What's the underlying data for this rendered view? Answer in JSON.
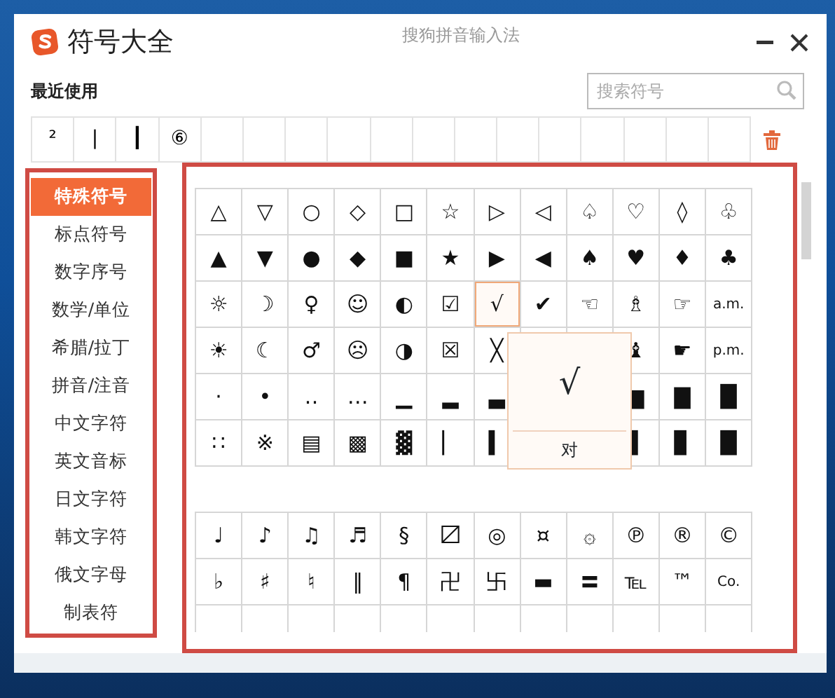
{
  "window": {
    "title": "符号大全",
    "subtitle": "搜狗拼音输入法"
  },
  "recent": {
    "label": "最近使用",
    "items": [
      "²",
      "|",
      "┃",
      "⑥"
    ]
  },
  "search": {
    "placeholder": "搜索符号"
  },
  "sidebar": {
    "items": [
      {
        "label": "特殊符号",
        "selected": true
      },
      {
        "label": "标点符号",
        "selected": false
      },
      {
        "label": "数字序号",
        "selected": false
      },
      {
        "label": "数学/单位",
        "selected": false
      },
      {
        "label": "希腊/拉丁",
        "selected": false
      },
      {
        "label": "拼音/注音",
        "selected": false
      },
      {
        "label": "中文字符",
        "selected": false
      },
      {
        "label": "英文音标",
        "selected": false
      },
      {
        "label": "日文字符",
        "selected": false
      },
      {
        "label": "韩文字符",
        "selected": false
      },
      {
        "label": "俄文字母",
        "selected": false
      },
      {
        "label": "制表符",
        "selected": false
      }
    ]
  },
  "blocks": [
    {
      "rows": [
        [
          {
            "symbol": "△",
            "selected": false
          },
          {
            "symbol": "▽",
            "selected": false
          },
          {
            "symbol": "○",
            "selected": false
          },
          {
            "symbol": "◇",
            "selected": false
          },
          {
            "symbol": "□",
            "selected": false
          },
          {
            "symbol": "☆",
            "selected": false
          },
          {
            "symbol": "▷",
            "selected": false
          },
          {
            "symbol": "◁",
            "selected": false
          },
          {
            "symbol": "♤",
            "selected": false
          },
          {
            "symbol": "♡",
            "selected": false
          },
          {
            "symbol": "◊",
            "selected": false
          },
          {
            "symbol": "♧",
            "selected": false
          }
        ],
        [
          {
            "symbol": "▲",
            "selected": false
          },
          {
            "symbol": "▼",
            "selected": false
          },
          {
            "symbol": "●",
            "selected": false
          },
          {
            "symbol": "◆",
            "selected": false
          },
          {
            "symbol": "■",
            "selected": false
          },
          {
            "symbol": "★",
            "selected": false
          },
          {
            "symbol": "▶",
            "selected": false
          },
          {
            "symbol": "◀",
            "selected": false
          },
          {
            "symbol": "♠",
            "selected": false
          },
          {
            "symbol": "♥",
            "selected": false
          },
          {
            "symbol": "♦",
            "selected": false
          },
          {
            "symbol": "♣",
            "selected": false
          }
        ],
        [
          {
            "symbol": "☼",
            "selected": false
          },
          {
            "symbol": "☽",
            "selected": false
          },
          {
            "symbol": "♀",
            "selected": false
          },
          {
            "symbol": "☺",
            "selected": false
          },
          {
            "symbol": "◐",
            "selected": false
          },
          {
            "symbol": "☑",
            "selected": false
          },
          {
            "symbol": "√",
            "selected": true
          },
          {
            "symbol": "✔",
            "selected": false
          },
          {
            "symbol": "☜",
            "selected": false
          },
          {
            "symbol": "♗",
            "selected": false
          },
          {
            "symbol": "☞",
            "selected": false
          },
          {
            "symbol": "a.m.",
            "selected": false
          }
        ],
        [
          {
            "symbol": "☀",
            "selected": false
          },
          {
            "symbol": "☾",
            "selected": false
          },
          {
            "symbol": "♂",
            "selected": false
          },
          {
            "symbol": "☹",
            "selected": false
          },
          {
            "symbol": "◑",
            "selected": false
          },
          {
            "symbol": "☒",
            "selected": false
          },
          {
            "symbol": "╳",
            "selected": false
          },
          null,
          null,
          {
            "symbol": "♝",
            "selected": false
          },
          {
            "symbol": "☛",
            "selected": false
          },
          {
            "symbol": "p.m.",
            "selected": false
          }
        ],
        [
          {
            "symbol": "·",
            "selected": false
          },
          {
            "symbol": "•",
            "selected": false
          },
          {
            "symbol": "‥",
            "selected": false
          },
          {
            "symbol": "…",
            "selected": false
          },
          {
            "symbol": "▁",
            "selected": false
          },
          {
            "symbol": "▂",
            "selected": false
          },
          {
            "symbol": "▃",
            "selected": false
          },
          null,
          null,
          {
            "symbol": "▆",
            "selected": false
          },
          {
            "symbol": "▇",
            "selected": false
          },
          {
            "symbol": "█",
            "selected": false
          }
        ],
        [
          {
            "symbol": "∷",
            "selected": false
          },
          {
            "symbol": "※",
            "selected": false
          },
          {
            "symbol": "▤",
            "selected": false
          },
          {
            "symbol": "▩",
            "selected": false
          },
          {
            "symbol": "▓",
            "selected": false
          },
          {
            "symbol": "▏",
            "selected": false
          },
          {
            "symbol": "▍",
            "selected": false
          },
          null,
          null,
          {
            "symbol": "▋",
            "selected": false
          },
          {
            "symbol": "▊",
            "selected": false
          },
          {
            "symbol": "█",
            "selected": false
          }
        ]
      ]
    },
    {
      "rows": [
        [
          {
            "symbol": "♩",
            "selected": false
          },
          {
            "symbol": "♪",
            "selected": false
          },
          {
            "symbol": "♫",
            "selected": false
          },
          {
            "symbol": "♬",
            "selected": false
          },
          {
            "symbol": "§",
            "selected": false
          },
          {
            "symbol": "〼",
            "selected": false
          },
          {
            "symbol": "◎",
            "selected": false
          },
          {
            "symbol": "¤",
            "selected": false
          },
          {
            "symbol": "۞",
            "selected": false
          },
          {
            "symbol": "℗",
            "selected": false
          },
          {
            "symbol": "®",
            "selected": false
          },
          {
            "symbol": "©",
            "selected": false
          }
        ],
        [
          {
            "symbol": "♭",
            "selected": false
          },
          {
            "symbol": "♯",
            "selected": false
          },
          {
            "symbol": "♮",
            "selected": false
          },
          {
            "symbol": "‖",
            "selected": false
          },
          {
            "symbol": "¶",
            "selected": false
          },
          {
            "symbol": "卍",
            "selected": false
          },
          {
            "symbol": "卐",
            "selected": false
          },
          {
            "symbol": "▬",
            "selected": false
          },
          {
            "symbol": "〓",
            "selected": false
          },
          {
            "symbol": "℡",
            "selected": false
          },
          {
            "symbol": "™",
            "selected": false
          },
          {
            "symbol": "Co.",
            "selected": false
          }
        ]
      ],
      "more_below": true
    }
  ],
  "popup": {
    "symbol": "√",
    "label": "对"
  }
}
